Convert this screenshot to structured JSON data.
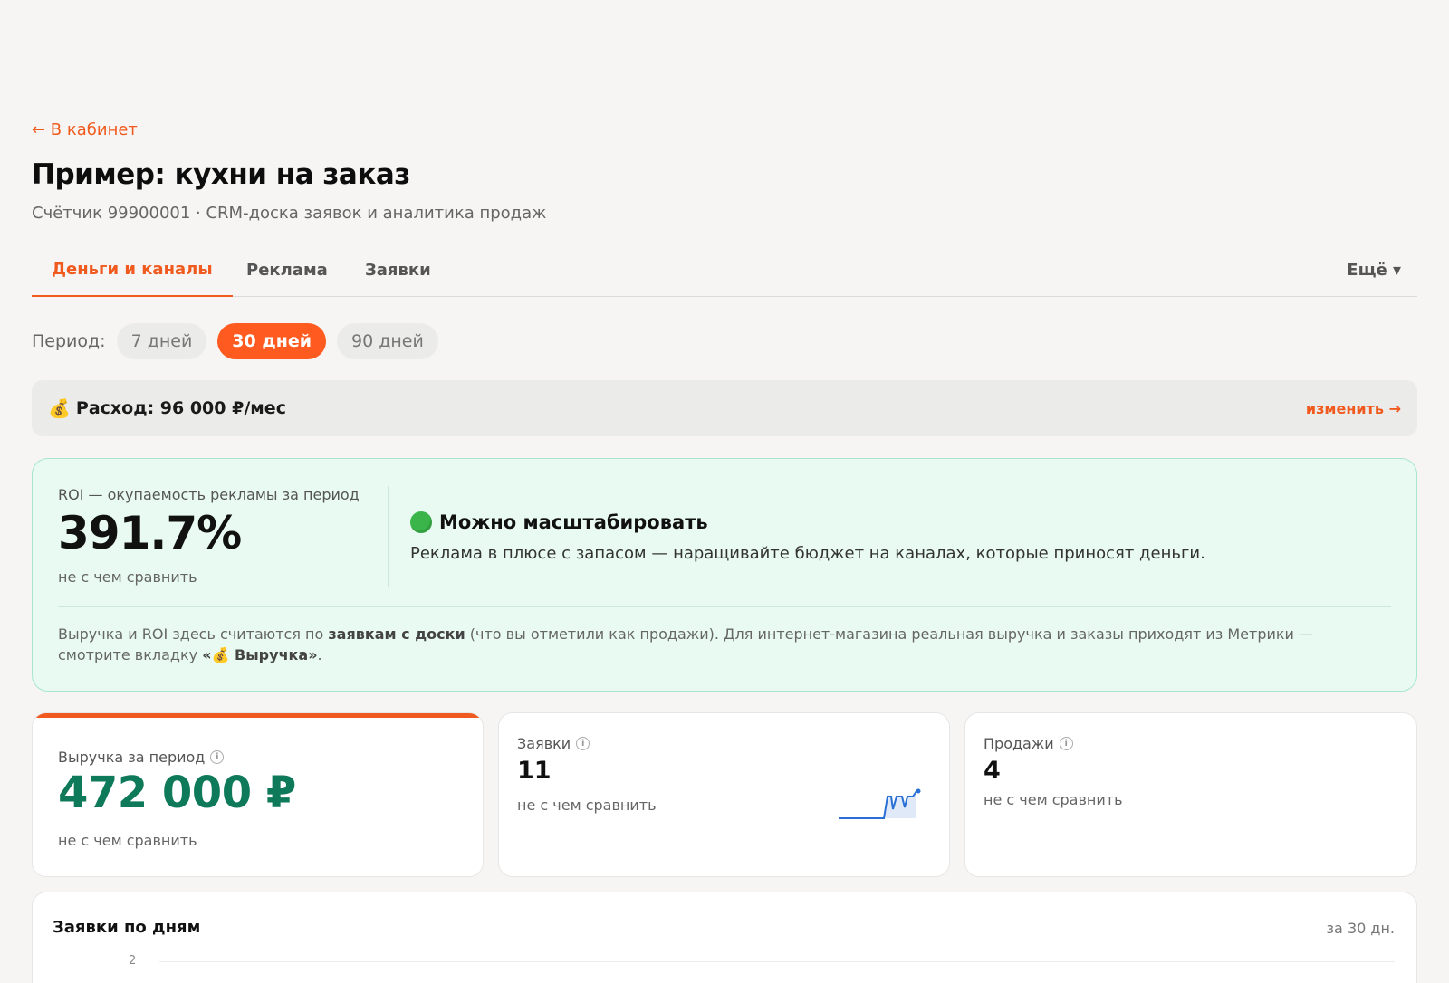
{
  "nav": {
    "back_label": "← В кабинет"
  },
  "header": {
    "title": "Пример: кухни на заказ",
    "subtitle": "Счётчик 99900001 · CRM-доска заявок и аналитика продаж"
  },
  "tabs": [
    {
      "label": "Деньги и каналы",
      "active": true
    },
    {
      "label": "Реклама",
      "active": false
    },
    {
      "label": "Заявки",
      "active": false
    }
  ],
  "tabs_more": "Ещё ▾",
  "period": {
    "label": "Период:",
    "options": [
      {
        "label": "7 дней",
        "active": false
      },
      {
        "label": "30 дней",
        "active": true
      },
      {
        "label": "90 дней",
        "active": false
      }
    ]
  },
  "spend": {
    "icon": "money-bag-icon",
    "text": "Расход: 96 000 ₽/мес",
    "link": "изменить →"
  },
  "roi": {
    "label": "ROI — окупаемость рекламы за период",
    "value": "391.7%",
    "compare": "не с чем сравнить",
    "verdict": "Можно масштабировать",
    "verdict_color": "#3ab54a",
    "description": "Реклама в плюсе с запасом — наращивайте бюджет на каналах, которые приносят деньги.",
    "note_part1": "Выручка и ROI здесь считаются по ",
    "note_bold1": "заявкам с доски",
    "note_part2": " (что вы отметили как продажи). Для интернет-магазина реальная выручка и заказы приходят из Метрики — смотрите вкладку ",
    "note_bold2": "«💰 Выручка»",
    "note_part3": "."
  },
  "cards": {
    "revenue": {
      "label": "Выручка за период",
      "value": "472 000 ₽",
      "compare": "не с чем сравнить"
    },
    "leads": {
      "label": "Заявки",
      "value": "11",
      "compare": "не с чем сравнить"
    },
    "sales": {
      "label": "Продажи",
      "value": "4",
      "compare": "не с чем сравнить"
    }
  },
  "daily": {
    "title": "Заявки по дням",
    "range": "за 30 дн.",
    "tick_top": "2"
  },
  "colors": {
    "accent": "#f05a1e",
    "revenue_green": "#0f7a5a",
    "sparkline": "#2a6fd6"
  }
}
